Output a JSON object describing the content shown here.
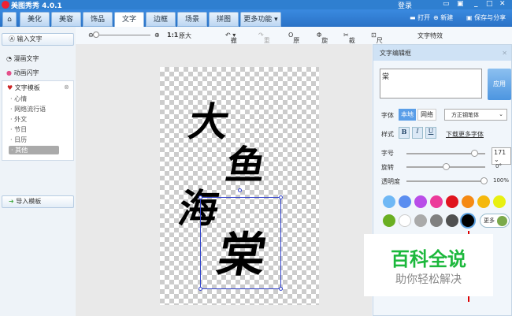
{
  "app": {
    "title": "美图秀秀 4.0.1",
    "login": "登录"
  },
  "tabs": [
    "美化",
    "美容",
    "饰品",
    "文字",
    "边框",
    "场景",
    "拼图",
    "更多功能 ▾"
  ],
  "active_tab": "文字",
  "top_actions": {
    "open": "打开",
    "new": "新建",
    "save": "保存与分享"
  },
  "toolbar": {
    "ratio": "1:1",
    "original": "原大",
    "undo": "撤销",
    "redo": "重做",
    "original_img": "原图",
    "rotate": "旋转",
    "crop": "裁剪",
    "size": "尺寸",
    "effects": "文字特效"
  },
  "sidebar": {
    "input_text": "输入文字",
    "comic_text": "漫画文字",
    "anim_text": "动画闪字",
    "template": "文字模板",
    "template_items": [
      "心情",
      "网络流行语",
      "外文",
      "节日",
      "日历",
      "其他"
    ],
    "import": "导入模板"
  },
  "canvas": {
    "text": [
      "大",
      "鱼",
      "海",
      "棠"
    ]
  },
  "panel": {
    "title": "文字编辑框",
    "text_value": "棠",
    "apply": "应用",
    "font_label": "字体",
    "local": "本地",
    "online": "网络",
    "font_value": "方正钢笔体",
    "style_label": "样式",
    "bold": "B",
    "italic": "I",
    "underline": "U",
    "download": "下载更多字体",
    "size_label": "字号",
    "size_value": "171",
    "rotate_label": "旋转",
    "rotate_value": "0°",
    "opacity_label": "透明度",
    "opacity_value": "100%",
    "more": "更多",
    "size_frac": 0.9,
    "rotate_frac": 0.5,
    "opacity_frac": 1.0,
    "colors_row1": [
      "#6fb8f5",
      "#5b8ef0",
      "#b94de8",
      "#ec3a9a",
      "#e0141e",
      "#f58a14",
      "#f5b80c",
      "#e8f012"
    ],
    "colors_row2": [
      "#6aaf22",
      "#ffffff",
      "#aaaaaa",
      "#808080",
      "#505050",
      "#000000"
    ],
    "selected_color": "#000000",
    "more_color": "#7aa94a"
  },
  "watermark": {
    "line1": "百科全说",
    "line2": "助你轻松解决"
  }
}
